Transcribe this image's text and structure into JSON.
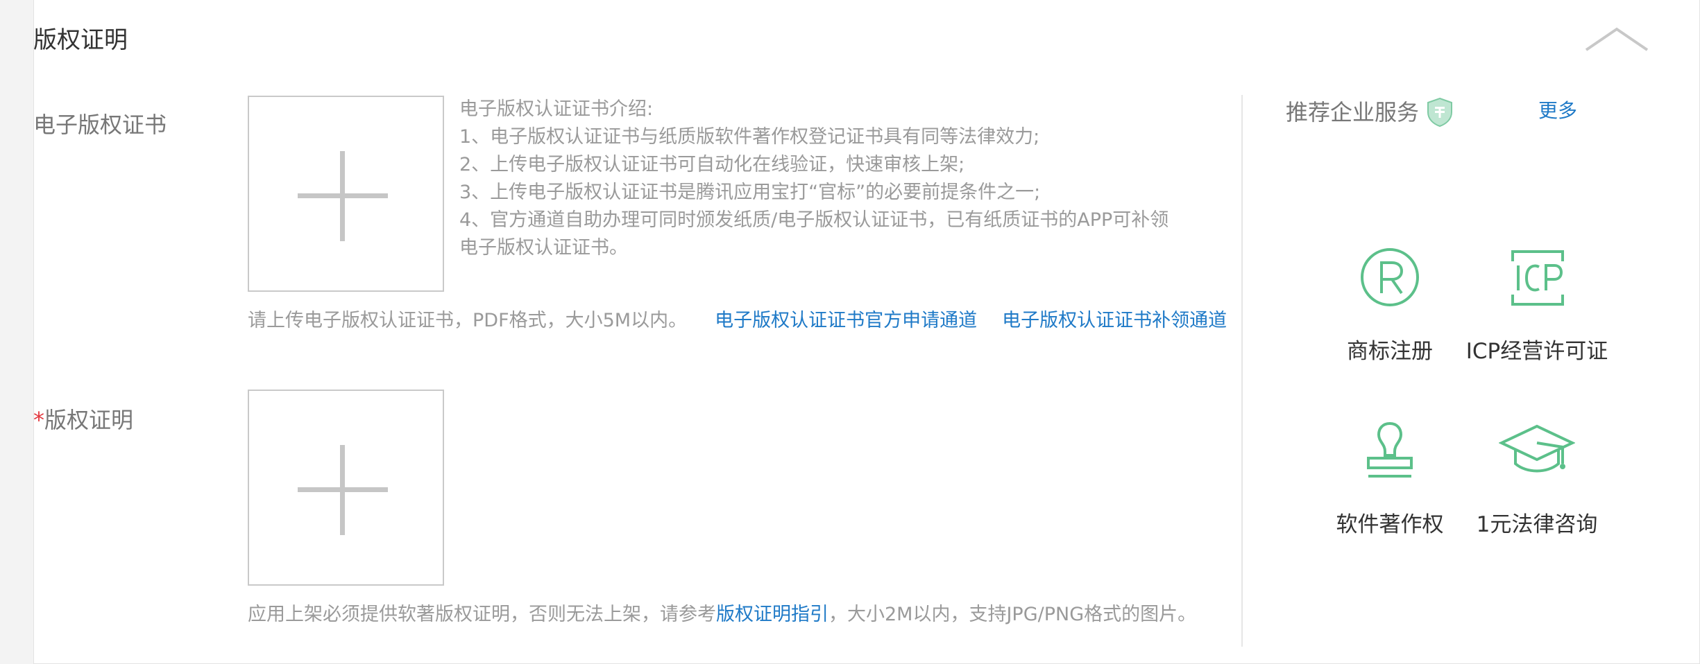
{
  "section": {
    "title": "版权证明"
  },
  "electronic_cert": {
    "label": "电子版权证书",
    "intro_lines": [
      "电子版权认证证书介绍:",
      "1、电子版权认证证书与纸质版软件著作权登记证书具有同等法律效力;",
      "2、上传电子版权认证证书可自动化在线验证，快速审核上架;",
      "3、上传电子版权认证证书是腾讯应用宝打“官标”的必要前提条件之一;",
      "4、官方通道自助办理可同时颁发纸质/电子版权认证证书，已有纸质证书的APP可补领",
      "电子版权认证证书。"
    ],
    "hint": "请上传电子版权认证证书，PDF格式，大小5M以内。",
    "link_apply": "电子版权认证证书官方申请通道",
    "link_reissue": "电子版权认证证书补领通道"
  },
  "copyright_proof": {
    "required_mark": "*",
    "label": "版权证明",
    "hint_prefix": "应用上架必须提供软著版权证明，否则无法上架，请参考",
    "hint_link": "版权证明指引",
    "hint_suffix": "，大小2M以内，支持JPG/PNG格式的图片。"
  },
  "sidebar": {
    "title": "推荐企业服务",
    "more": "更多",
    "services": [
      {
        "label": "商标注册",
        "icon": "trademark-icon"
      },
      {
        "label": "ICP经营许可证",
        "icon": "icp-icon"
      },
      {
        "label": "软件著作权",
        "icon": "stamp-icon"
      },
      {
        "label": "1元法律咨询",
        "icon": "graduation-cap-icon"
      }
    ]
  },
  "colors": {
    "accent_green": "#5cc08a",
    "link_blue": "#1f7ac7",
    "required_red": "#e2383f"
  }
}
